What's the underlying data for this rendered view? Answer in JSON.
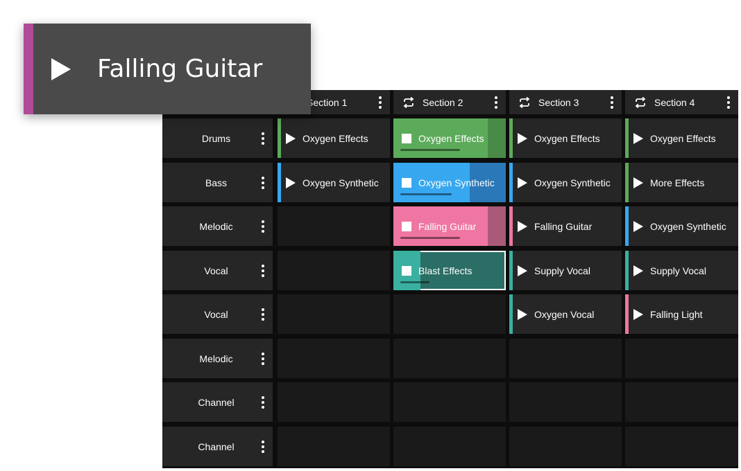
{
  "popup": {
    "title": "Falling Guitar",
    "accent": "#b04a9a"
  },
  "colors": {
    "green": "#5cab5a",
    "green_dark": "#4a8a48",
    "blue": "#37a8f0",
    "blue_dark": "#2a78b8",
    "pink": "#ef76a3",
    "pink_dark": "#a95a78",
    "teal": "#39b0a0",
    "teal_dark": "#2a6e66"
  },
  "sections": [
    {
      "label": "Section 1",
      "loop_icon": "loop-icon"
    },
    {
      "label": "Section 2",
      "loop_icon": "loop-icon"
    },
    {
      "label": "Section 3",
      "loop_icon": "loop-icon"
    },
    {
      "label": "Section 4",
      "loop_icon": "loop-icon"
    }
  ],
  "tracks": [
    {
      "name": "Drums"
    },
    {
      "name": "Bass"
    },
    {
      "name": "Melodic"
    },
    {
      "name": "Vocal"
    },
    {
      "name": "Vocal"
    },
    {
      "name": "Melodic"
    },
    {
      "name": "Channel"
    },
    {
      "name": "Channel"
    }
  ],
  "clips": [
    [
      {
        "label": "Oxygen Effects",
        "color": "green",
        "state": "stopped"
      },
      {
        "label": "Oxygen Effects",
        "color": "green",
        "state": "playing",
        "progress": 0.84
      },
      {
        "label": "Oxygen Effects",
        "color": "green",
        "state": "stopped"
      },
      {
        "label": "Oxygen Effects",
        "color": "green",
        "state": "stopped"
      }
    ],
    [
      {
        "label": "Oxygen Synthetic",
        "color": "blue",
        "state": "stopped"
      },
      {
        "label": "Oxygen Synthetic",
        "color": "blue",
        "state": "playing",
        "progress": 0.68
      },
      {
        "label": "Oxygen Synthetic",
        "color": "blue",
        "state": "stopped"
      },
      {
        "label": "More Effects",
        "color": "green",
        "state": "stopped"
      }
    ],
    [
      null,
      {
        "label": "Falling Guitar",
        "color": "pink",
        "state": "playing",
        "progress": 0.84
      },
      {
        "label": "Falling Guitar",
        "color": "pink",
        "state": "stopped"
      },
      {
        "label": "Oxygen Synthetic",
        "color": "blue",
        "state": "stopped"
      }
    ],
    [
      null,
      {
        "label": "Blast Effects",
        "color": "teal",
        "state": "playing",
        "progress": 0.24,
        "selected": true
      },
      {
        "label": "Supply Vocal",
        "color": "teal",
        "state": "stopped"
      },
      {
        "label": "Supply Vocal",
        "color": "teal",
        "state": "stopped"
      }
    ],
    [
      null,
      null,
      {
        "label": "Oxygen Vocal",
        "color": "teal",
        "state": "stopped"
      },
      {
        "label": "Falling Light",
        "color": "pink",
        "state": "stopped"
      }
    ],
    [
      null,
      null,
      null,
      null
    ],
    [
      null,
      null,
      null,
      null
    ],
    [
      null,
      null,
      null,
      null
    ]
  ]
}
